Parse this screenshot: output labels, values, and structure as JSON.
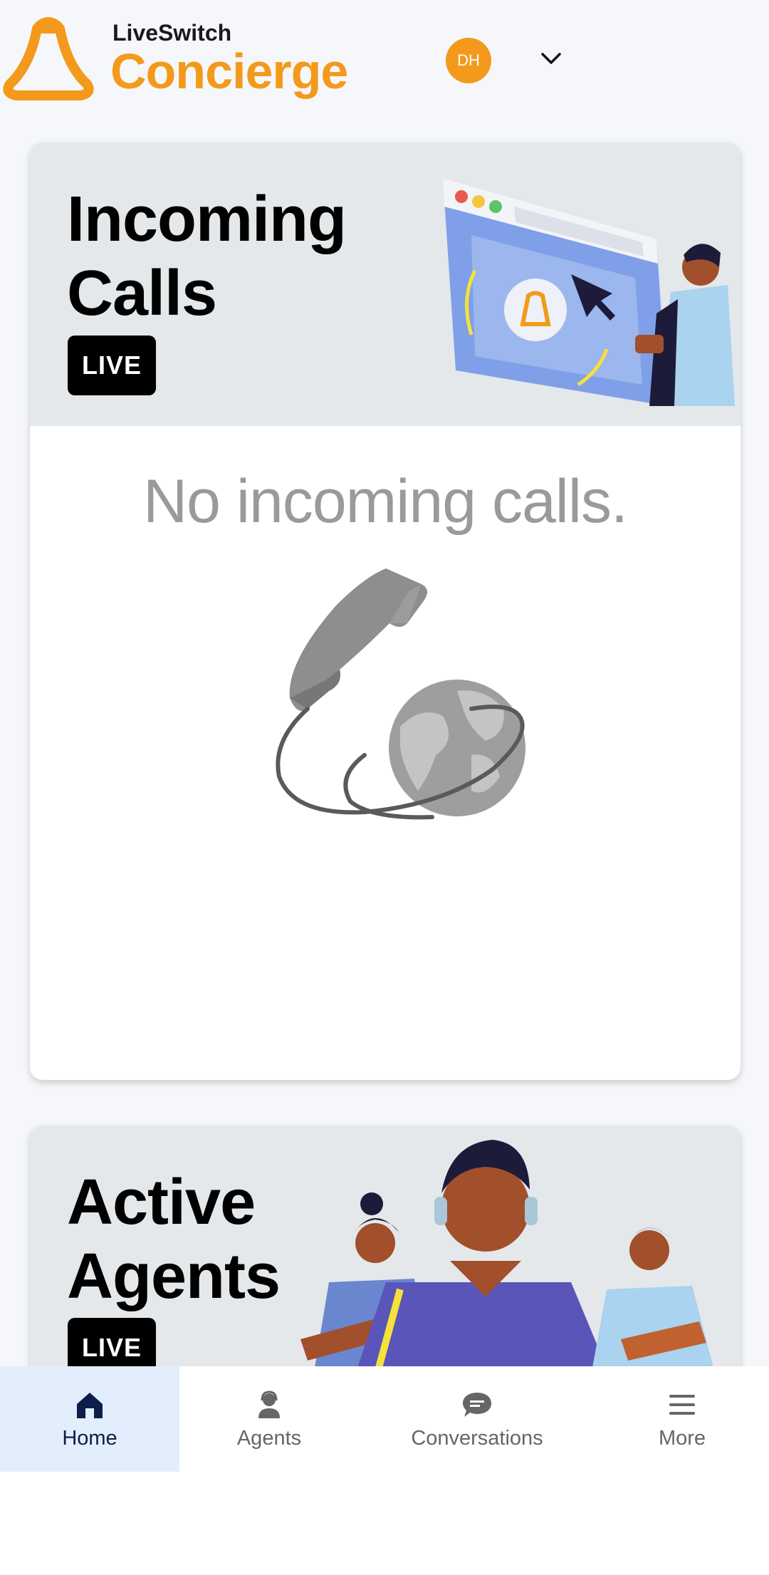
{
  "header": {
    "brand_small": "LiveSwitch",
    "brand_name": "Concierge",
    "avatar_initials": "DH",
    "accent_color": "#f39a1c"
  },
  "incoming": {
    "title_line1": "Incoming",
    "title_line2": "Calls",
    "badge": "LIVE",
    "empty_message": "No incoming calls."
  },
  "agents": {
    "title_line1": "Active",
    "title_line2": "Agents",
    "badge": "LIVE"
  },
  "nav": {
    "items": [
      {
        "label": "Home",
        "icon": "home-icon",
        "active": true
      },
      {
        "label": "Agents",
        "icon": "agent-icon",
        "active": false
      },
      {
        "label": "Conversations",
        "icon": "chat-bubble-icon",
        "active": false
      },
      {
        "label": "More",
        "icon": "menu-icon",
        "active": false
      }
    ]
  }
}
